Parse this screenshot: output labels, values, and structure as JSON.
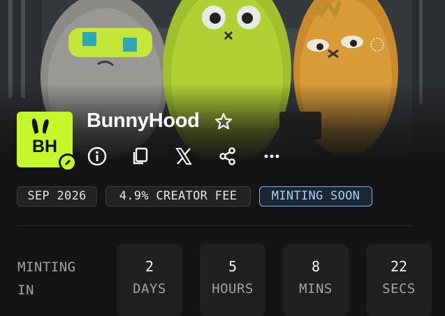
{
  "banner": {
    "image_name": "bunnyhood-plush-characters-banner"
  },
  "collection": {
    "logo_text": "BH",
    "name": "BunnyHood",
    "accent_color": "#c4f82a",
    "icons": [
      "star-outline-icon",
      "info-icon",
      "copy-icon",
      "x-logo-icon",
      "share-icon",
      "more-icon",
      "pencil-icon"
    ]
  },
  "chips": [
    {
      "label": "SEP 2026"
    },
    {
      "label": "4.9% CREATOR FEE"
    },
    {
      "label": "MINTING SOON"
    }
  ],
  "countdown": {
    "label_line1": "MINTING",
    "label_line2": "IN",
    "units": [
      {
        "value": "2",
        "unit": "DAYS"
      },
      {
        "value": "5",
        "unit": "HOURS"
      },
      {
        "value": "8",
        "unit": "MINS"
      },
      {
        "value": "22",
        "unit": "SECS"
      }
    ]
  }
}
